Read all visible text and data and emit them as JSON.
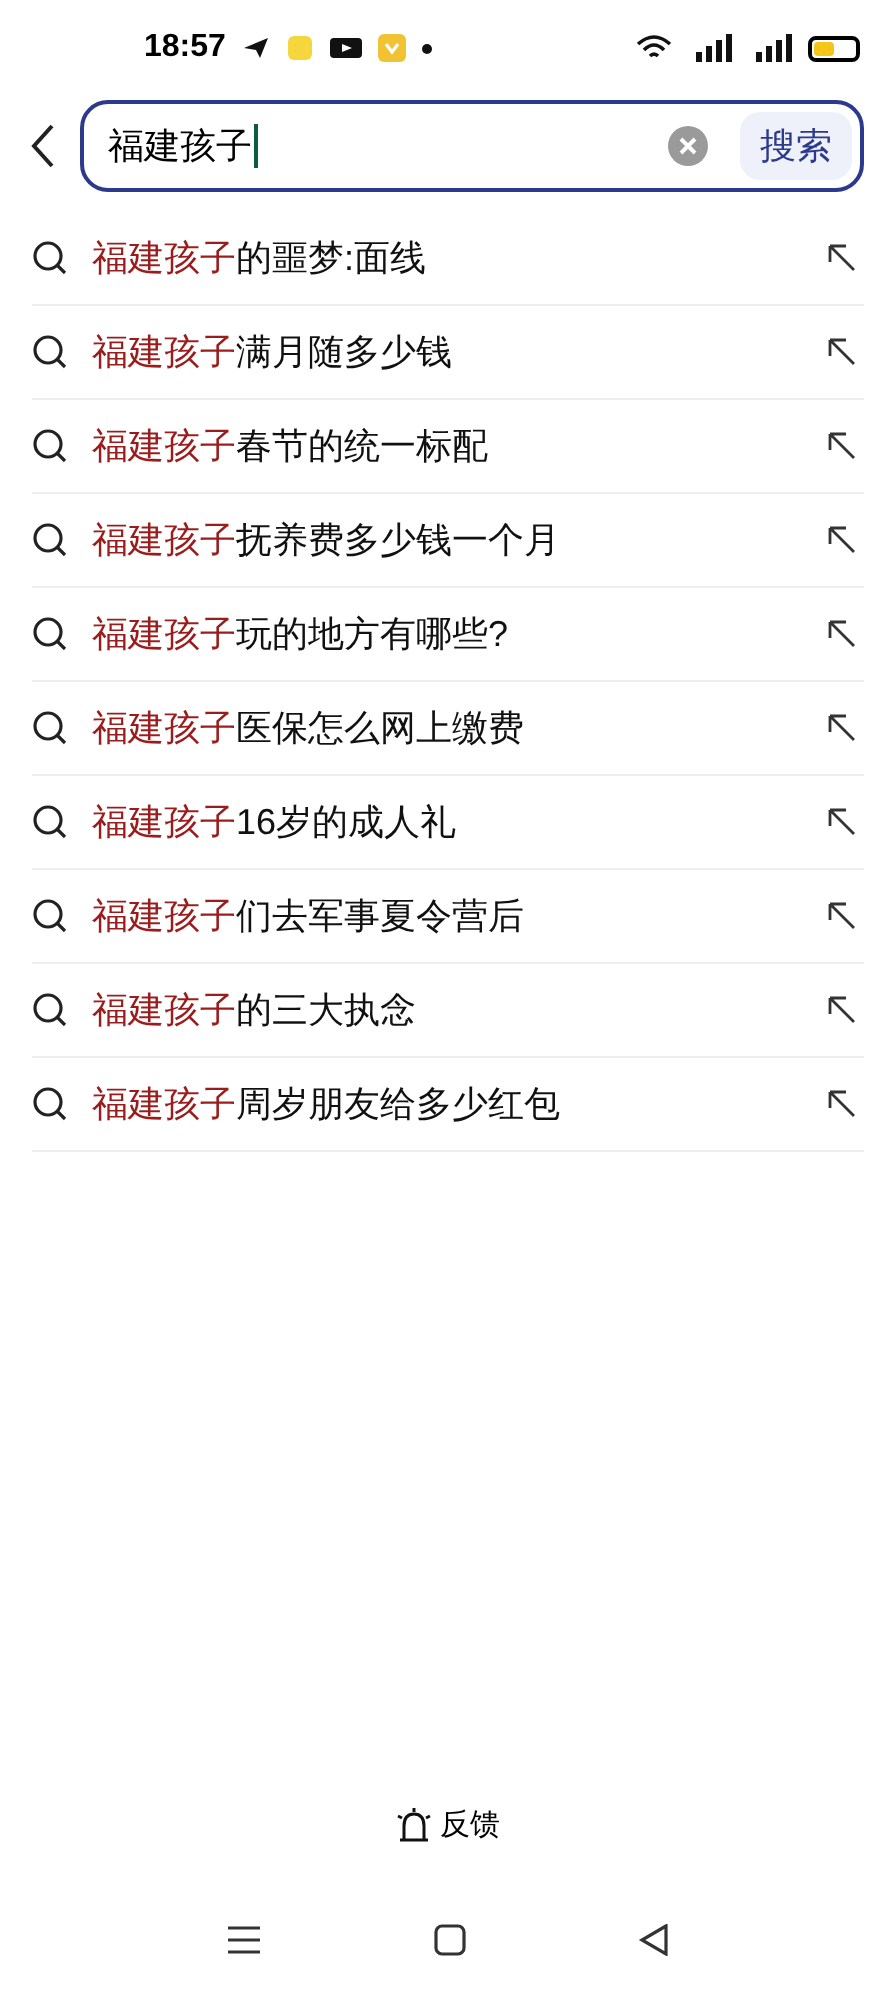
{
  "status_bar": {
    "time": "18:57"
  },
  "search": {
    "value": "福建孩子",
    "button": "搜索"
  },
  "suggestions": [
    {
      "match": "福建孩子",
      "rest": "的噩梦:面线"
    },
    {
      "match": "福建孩子",
      "rest": "满月随多少钱"
    },
    {
      "match": "福建孩子",
      "rest": "春节的统一标配"
    },
    {
      "match": "福建孩子",
      "rest": "抚养费多少钱一个月"
    },
    {
      "match": "福建孩子",
      "rest": "玩的地方有哪些?"
    },
    {
      "match": "福建孩子",
      "rest": "医保怎么网上缴费"
    },
    {
      "match": "福建孩子",
      "rest": "16岁的成人礼"
    },
    {
      "match": "福建孩子",
      "rest": "们去军事夏令营后"
    },
    {
      "match": "福建孩子",
      "rest": "的三大执念"
    },
    {
      "match": "福建孩子",
      "rest": "周岁朋友给多少红包"
    }
  ],
  "feedback": "反馈"
}
